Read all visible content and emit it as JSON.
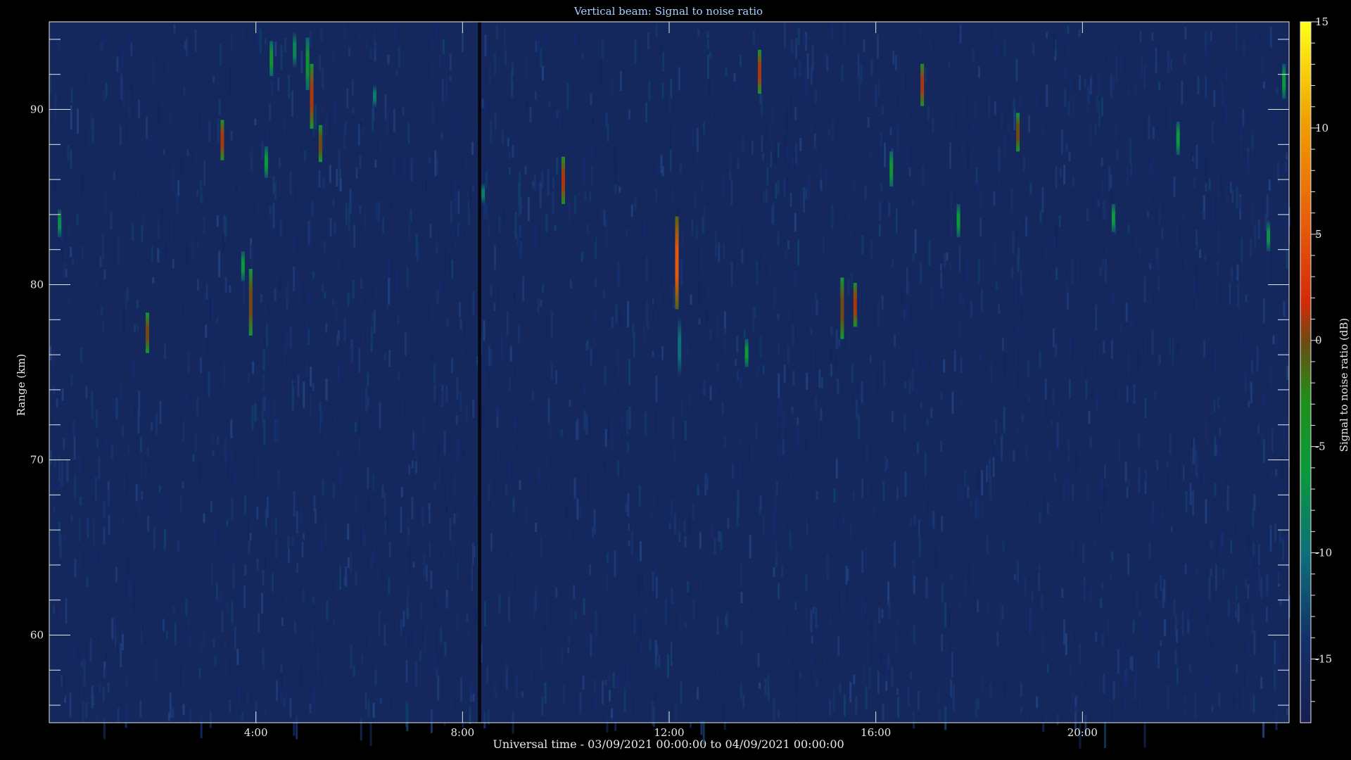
{
  "chart_data": {
    "type": "heatmap",
    "title": "Vertical beam: Signal to noise ratio",
    "xlabel": "Universal time - 03/09/2021 00:00:00 to 04/09/2021 00:00:00",
    "ylabel": "Range (km)",
    "colorbar_label": "Signal to noise ratio (dB)",
    "x_unit": "hours UT",
    "xlim": [
      0,
      24
    ],
    "ylim": [
      55,
      95
    ],
    "clim": [
      -18,
      15
    ],
    "x_ticks": [
      {
        "value": 4,
        "label": "4:00"
      },
      {
        "value": 8,
        "label": "8:00"
      },
      {
        "value": 12,
        "label": "12:00"
      },
      {
        "value": 16,
        "label": "16:00"
      },
      {
        "value": 20,
        "label": "20:00"
      }
    ],
    "y_ticks": [
      {
        "value": 60,
        "label": "60"
      },
      {
        "value": 70,
        "label": "70"
      },
      {
        "value": 80,
        "label": "80"
      },
      {
        "value": 90,
        "label": "90"
      }
    ],
    "colorbar_ticks": [
      {
        "value": 15,
        "label": "15"
      },
      {
        "value": 10,
        "label": "10"
      },
      {
        "value": 5,
        "label": "5"
      },
      {
        "value": 0,
        "label": "0"
      },
      {
        "value": -5,
        "label": "-5"
      },
      {
        "value": -10,
        "label": "-10"
      },
      {
        "value": -15,
        "label": "-15"
      }
    ],
    "background_snr_db": -16,
    "data_gap": {
      "start": 8.3,
      "end": 8.36
    },
    "echoes": [
      {
        "time": 0.2,
        "range_min": 82.7,
        "range_max": 84.3,
        "snr_db": -7
      },
      {
        "time": 1.9,
        "range_min": 76.1,
        "range_max": 78.4,
        "snr_db": 0
      },
      {
        "time": 3.35,
        "range_min": 87.1,
        "range_max": 89.4,
        "snr_db": 1
      },
      {
        "time": 3.75,
        "range_min": 80.2,
        "range_max": 81.9,
        "snr_db": -6
      },
      {
        "time": 3.9,
        "range_min": 77.1,
        "range_max": 80.9,
        "snr_db": 0
      },
      {
        "time": 4.2,
        "range_min": 86.1,
        "range_max": 87.9,
        "snr_db": -6
      },
      {
        "time": 4.3,
        "range_min": 91.9,
        "range_max": 93.9,
        "snr_db": -5
      },
      {
        "time": 4.75,
        "range_min": 92.4,
        "range_max": 94.4,
        "snr_db": -8
      },
      {
        "time": 5.0,
        "range_min": 91.1,
        "range_max": 94.1,
        "snr_db": -5
      },
      {
        "time": 5.08,
        "range_min": 88.9,
        "range_max": 92.6,
        "snr_db": 1
      },
      {
        "time": 5.25,
        "range_min": 87.0,
        "range_max": 89.1,
        "snr_db": 0
      },
      {
        "time": 6.3,
        "range_min": 90.1,
        "range_max": 91.4,
        "snr_db": -9
      },
      {
        "time": 8.4,
        "range_min": 84.6,
        "range_max": 85.8,
        "snr_db": -9
      },
      {
        "time": 9.95,
        "range_min": 84.6,
        "range_max": 87.3,
        "snr_db": 1
      },
      {
        "time": 12.15,
        "range_min": 78.6,
        "range_max": 83.9,
        "snr_db": 5
      },
      {
        "time": 12.2,
        "range_min": 74.7,
        "range_max": 78.2,
        "snr_db": -10
      },
      {
        "time": 13.5,
        "range_min": 75.3,
        "range_max": 76.9,
        "snr_db": -6
      },
      {
        "time": 13.75,
        "range_min": 90.9,
        "range_max": 93.4,
        "snr_db": 1
      },
      {
        "time": 15.35,
        "range_min": 76.9,
        "range_max": 80.4,
        "snr_db": 0
      },
      {
        "time": 15.6,
        "range_min": 77.6,
        "range_max": 80.1,
        "snr_db": 1
      },
      {
        "time": 16.3,
        "range_min": 85.6,
        "range_max": 87.6,
        "snr_db": -5
      },
      {
        "time": 16.9,
        "range_min": 90.2,
        "range_max": 92.6,
        "snr_db": 1
      },
      {
        "time": 17.6,
        "range_min": 82.7,
        "range_max": 84.6,
        "snr_db": -6
      },
      {
        "time": 18.75,
        "range_min": 87.6,
        "range_max": 89.8,
        "snr_db": 0
      },
      {
        "time": 20.6,
        "range_min": 83.0,
        "range_max": 84.6,
        "snr_db": -6
      },
      {
        "time": 21.85,
        "range_min": 87.4,
        "range_max": 89.3,
        "snr_db": -6
      },
      {
        "time": 23.6,
        "range_min": 81.9,
        "range_max": 83.6,
        "snr_db": -7
      },
      {
        "time": 23.9,
        "range_min": 90.6,
        "range_max": 92.6,
        "snr_db": -6
      }
    ]
  }
}
